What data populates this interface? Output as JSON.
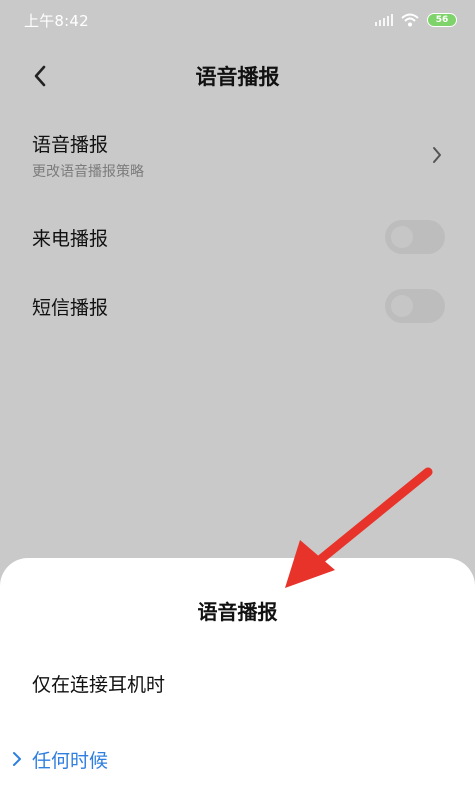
{
  "status_bar": {
    "time": "上午8:42",
    "battery": "56",
    "signal_icon": "signal-icon",
    "wifi_icon": "wifi-icon",
    "battery_icon": "battery-icon"
  },
  "header": {
    "title": "语音播报",
    "back_icon": "chevron-left-icon"
  },
  "settings": {
    "voice_title": "语音播报",
    "voice_subtitle": "更改语音播报策略",
    "call_label": "来电播报",
    "sms_label": "短信播报"
  },
  "sheet": {
    "title": "语音播报",
    "options": [
      {
        "label": "仅在连接耳机时",
        "selected": false
      },
      {
        "label": "任何时候",
        "selected": true
      }
    ]
  },
  "colors": {
    "overlay": "#c9c9c9",
    "accent": "#2f7fe0",
    "annotation": "#e8332a"
  }
}
